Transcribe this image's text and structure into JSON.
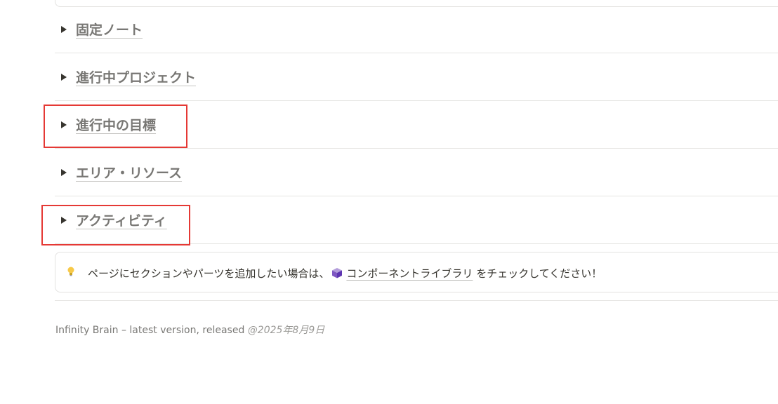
{
  "toggles": [
    {
      "title": "固定ノート"
    },
    {
      "title": "進行中プロジェクト"
    },
    {
      "title": "進行中の目標"
    },
    {
      "title": "エリア・リソース"
    },
    {
      "title": "アクティビティ"
    }
  ],
  "callout": {
    "icon": "lightbulb-icon",
    "text_before": "ページにセクションやパーツを追加したい場合は、",
    "link_icon": "package-icon",
    "link_text": "コンポーネントライブラリ",
    "text_after": " をチェックしてください！"
  },
  "footer": {
    "text": "Infinity Brain – latest version, released ",
    "date": "@2025年8月9日"
  },
  "colors": {
    "highlight": "#e53935",
    "heading": "#787774",
    "text": "#37352f"
  }
}
